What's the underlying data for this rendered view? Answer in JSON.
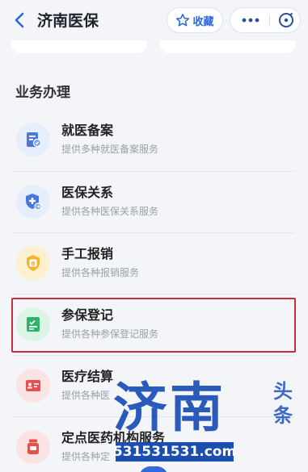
{
  "header": {
    "title": "济南医保",
    "favorite_label": "收藏"
  },
  "section": {
    "title": "业务办理"
  },
  "items": [
    {
      "name": "就医备案",
      "desc": "提供多种就医备案服务"
    },
    {
      "name": "医保关系",
      "desc": "提供各种医保关系服务"
    },
    {
      "name": "手工报销",
      "desc": "提供各种报销服务"
    },
    {
      "name": "参保登记",
      "desc": "提供各种参保登记服务"
    },
    {
      "name": "医疗结算",
      "desc": "提供各种医"
    },
    {
      "name": "定点医药机构服务",
      "desc": "提供各种定"
    }
  ],
  "watermark": {
    "big": "济南",
    "side": "头条",
    "number": "531531531.com"
  },
  "colors": {
    "accent": "#2c66d9",
    "highlight_border": "#c3303c",
    "icon_blue_bg": "#e6eefb",
    "icon_yellow_bg": "#fdf0cf",
    "icon_green_bg": "#dcf4e6",
    "icon_red_bg": "#fbe3e3"
  },
  "icons": [
    "chevron-left-icon",
    "star-icon",
    "more-icon",
    "close-circle-icon",
    "medical-record-icon",
    "shield-plus-icon",
    "badge-b-icon",
    "id-card-icon",
    "receipt-icon",
    "pill-bottle-icon"
  ]
}
